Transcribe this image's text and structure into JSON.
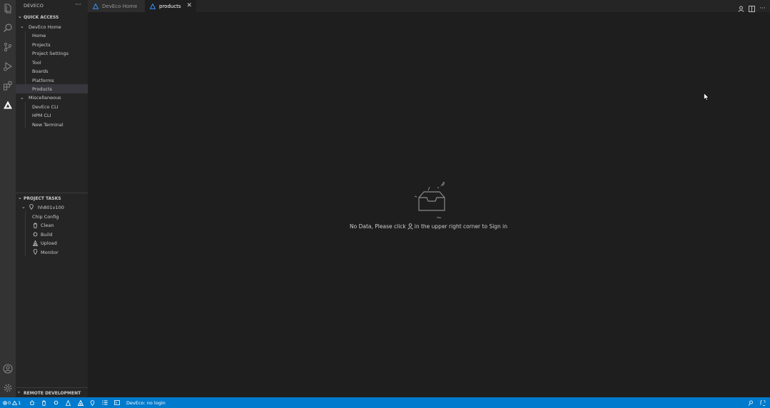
{
  "sidebar": {
    "title": "DEVECO",
    "more": "···",
    "quick_access": {
      "header": "QUICK ACCESS",
      "groups": [
        {
          "label": "DevEco Home",
          "items": [
            "Home",
            "Projects",
            "Project Settings",
            "Tool",
            "Boards",
            "Platforms",
            "Products"
          ]
        },
        {
          "label": "Miscellaneous",
          "items": [
            "DevEco CLI",
            "HPM CLI",
            "New Terminal"
          ]
        }
      ],
      "selected": "Products"
    },
    "project_tasks": {
      "header": "PROJECT TASKS",
      "project": "hh801v100",
      "tasks": [
        {
          "label": "Chip Config",
          "icon": null
        },
        {
          "label": "Clean",
          "icon": "trash-icon"
        },
        {
          "label": "Build",
          "icon": "circle-icon"
        },
        {
          "label": "Upload",
          "icon": "flame-icon"
        },
        {
          "label": "Monitor",
          "icon": "plug-icon"
        }
      ]
    },
    "remote_development": {
      "header": "REMOTE DEVELOPMENT"
    }
  },
  "tabs": [
    {
      "label": "DevEco Home",
      "icon": "deveco-logo-icon",
      "active": false
    },
    {
      "label": "products",
      "icon": "deveco-logo-icon",
      "active": true,
      "close": "✕"
    }
  ],
  "editor": {
    "empty_message_before": "No Data, Please click",
    "empty_message_after": "in the upper right corner to Sign in"
  },
  "statusbar": {
    "errors": "0",
    "warnings": "1",
    "login_status": "DevEco: no login"
  },
  "colors": {
    "accent": "#007acc",
    "activity_bar": "#333333",
    "sidebar": "#252526",
    "editor": "#1e1e1e",
    "selection": "#37373d"
  }
}
